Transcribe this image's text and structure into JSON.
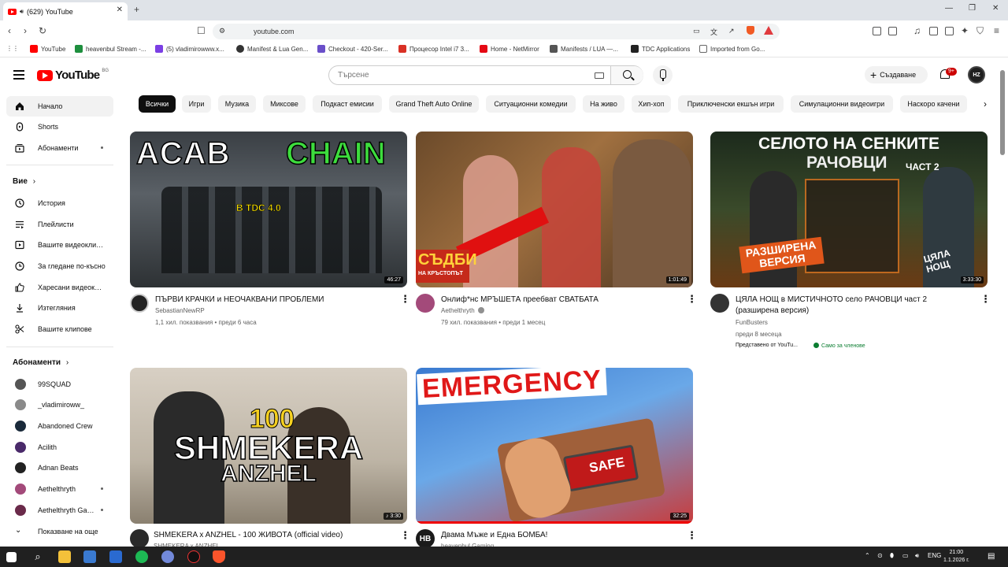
{
  "browser": {
    "tab_title": "(629) YouTube",
    "url": "youtube.com",
    "bookmarks": [
      {
        "label": "YouTube",
        "color": "#ff0000"
      },
      {
        "label": "heavenbul Stream -...",
        "color": "#1e8f3e"
      },
      {
        "label": "(5) vladimirowww.x...",
        "color": "#7b3fe4"
      },
      {
        "label": "Manifest & Lua Gen...",
        "color": "#333333"
      },
      {
        "label": "Checkout - 420-Ser...",
        "color": "#6a4fc9"
      },
      {
        "label": "Процесор Intel i7 3...",
        "color": "#d93025"
      },
      {
        "label": "Home - NetMirror",
        "color": "#e50914"
      },
      {
        "label": "Manifests / LUA —...",
        "color": "#555555"
      },
      {
        "label": "TDC Applications",
        "color": "#222222"
      },
      {
        "label": "Imported from Go...",
        "color": "#f5f5f5"
      }
    ]
  },
  "header": {
    "logo_text": "YouTube",
    "logo_region": "BG",
    "search_placeholder": "Търсене",
    "create_label": "Създаване",
    "notification_badge": "9+",
    "avatar_text": "HZ"
  },
  "sidebar": {
    "main": [
      {
        "label": "Начало",
        "icon": "home-icon",
        "active": true
      },
      {
        "label": "Shorts",
        "icon": "shorts-icon"
      },
      {
        "label": "Абонаменти",
        "icon": "subscriptions-icon",
        "dot": true
      }
    ],
    "you_heading": "Вие",
    "you": [
      {
        "label": "История",
        "icon": "history-icon"
      },
      {
        "label": "Плейлисти",
        "icon": "playlists-icon"
      },
      {
        "label": "Вашите видеоклипове",
        "icon": "your-videos-icon"
      },
      {
        "label": "За гледане по-късно",
        "icon": "watch-later-icon"
      },
      {
        "label": "Харесани видеоклипове",
        "icon": "liked-icon"
      },
      {
        "label": "Изтегляния",
        "icon": "download-icon"
      },
      {
        "label": "Вашите клипове",
        "icon": "clips-icon"
      }
    ],
    "subs_heading": "Абонаменти",
    "subscriptions": [
      {
        "label": "99SQUAD",
        "color": "#555555"
      },
      {
        "label": "_vladimiroww_",
        "color": "#8a8a8a"
      },
      {
        "label": "Abandoned Crew",
        "color": "#1a2a3a"
      },
      {
        "label": "Acilith",
        "color": "#4a2a6a"
      },
      {
        "label": "Adnan Beats",
        "color": "#222222"
      },
      {
        "label": "Aethelthryth",
        "color": "#a34a7a",
        "dot": true
      },
      {
        "label": "Aethelthryth Gaming",
        "color": "#6a2a4a",
        "dot": true
      }
    ],
    "show_more": "Показване на още"
  },
  "chips": [
    "Всички",
    "Игри",
    "Музика",
    "Миксове",
    "Подкаст емисии",
    "Grand Theft Auto Online",
    "Ситуационни комедии",
    "На живо",
    "Хип-хоп",
    "Приключенски екшън игри",
    "Симулационни видеоигри",
    "Наскоро качени"
  ],
  "videos": [
    {
      "title": "ПЪРВИ КРАЧКИ и НЕОЧАКВАНИ ПРОБЛЕМИ",
      "channel": "SebastianNewRP",
      "meta": "1,1 хил. показвания • преди 6 часа",
      "duration": "46:27",
      "thumb_text": "ACAB",
      "thumb_text2": "CHAIN",
      "thumb_text3": "В TDC 4.0",
      "avatar_color": "#222222"
    },
    {
      "title": "Онлиф*нс МРЪШЕТА преебват СВАТБАТА",
      "channel": "Aethelthryth",
      "meta": "79 хил. показвания • преди 1 месец",
      "duration": "1:01:49",
      "thumb_text": "СЪДБИ",
      "thumb_text2": "НА КРЪСТОПЪТ",
      "avatar_color": "#a34a7a",
      "verified": true
    },
    {
      "title": "ЦЯЛА НОЩ в МИСТИЧНОТО село РАЧОВЦИ част 2 (разширена версия)",
      "channel": "FunBusters",
      "meta": "преди 8 месеца",
      "extra": "Представено от YouTu...",
      "members": "Само за членове",
      "duration": "3:33:30",
      "thumb_text": "СЕЛОТО НА СЕНКИТЕ",
      "thumb_text2": "РАЧОВЦИ",
      "thumb_text3": "ЧАСТ 2",
      "thumb_text4": "РАЗШИРЕНА ВЕРСИЯ",
      "thumb_text5": "ЦЯЛА НОЩ",
      "avatar_color": "#333333"
    },
    {
      "title": "SHMEKERA x ANZHEL - 100 ЖИВОТА (official video)",
      "channel": "SHMEKERA x ANZHEL",
      "duration": "3:30",
      "thumb_text": "100",
      "thumb_text2": "SHMEKERA",
      "thumb_text3": "ANZHEL",
      "avatar_color": "#2a2a2a"
    },
    {
      "title": "Двама Мъже и Една БОМБА!",
      "channel": "heavenbul Gaming",
      "duration": "32:25",
      "thumb_text": "EMERGENCY",
      "thumb_text2": "SAFE",
      "avatar_color": "#1a1a1a"
    }
  ],
  "taskbar": {
    "lang": "ENG",
    "time": "21:00",
    "date": "1.1.2026 г."
  }
}
